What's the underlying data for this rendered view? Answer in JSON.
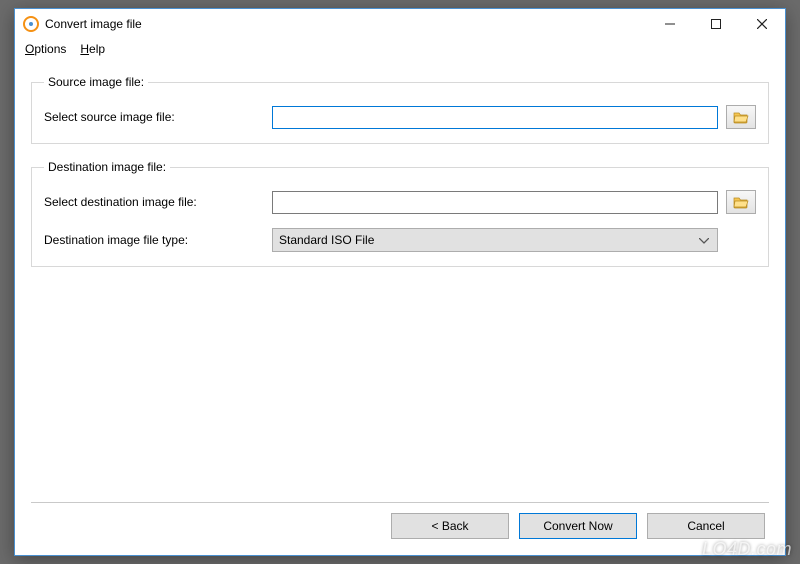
{
  "window": {
    "title": "Convert image file"
  },
  "menu": {
    "options": "Options",
    "help": "Help"
  },
  "source": {
    "legend": "Source image file:",
    "label": "Select source image file:",
    "value": ""
  },
  "destination": {
    "legend": "Destination image file:",
    "select_label": "Select destination image file:",
    "select_value": "",
    "type_label": "Destination image file type:",
    "type_value": "Standard ISO File"
  },
  "footer": {
    "back": "< Back",
    "convert": "Convert Now",
    "cancel": "Cancel"
  },
  "watermark": "LO4D.com"
}
